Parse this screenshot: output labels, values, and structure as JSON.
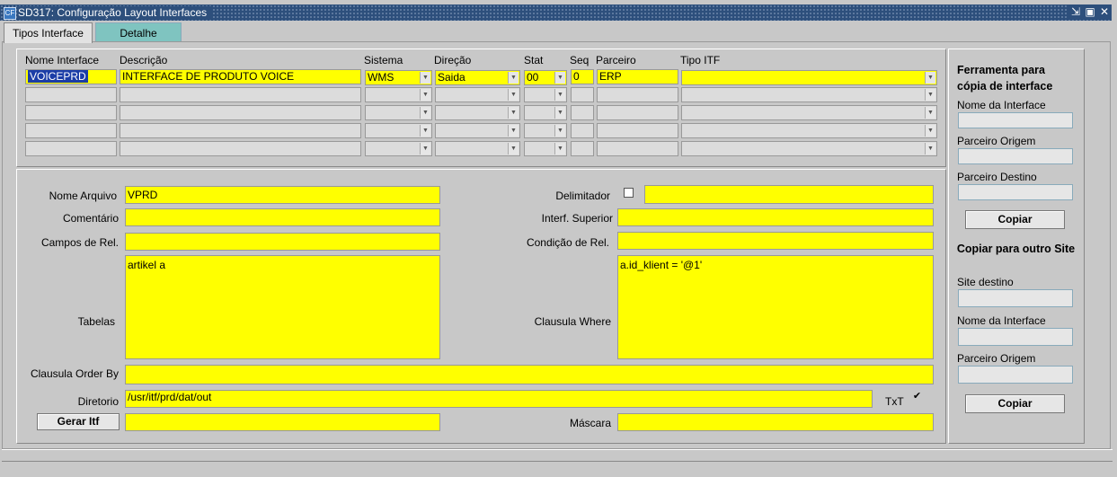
{
  "window": {
    "title": "SD317: Configuração Layout Interfaces",
    "buttons": [
      "⇲",
      "▣",
      "✕"
    ]
  },
  "tabs": [
    {
      "label": "Tipos Interface"
    },
    {
      "label": "Detalhe"
    }
  ],
  "grid": {
    "headers": [
      "Nome Interface",
      "Descrição",
      "Sistema",
      "Direção",
      "Stat",
      "Seq",
      "Parceiro",
      "Tipo ITF"
    ],
    "row1": {
      "nome": "VOICEPRD",
      "descricao": "INTERFACE DE PRODUTO VOICE",
      "sistema": "WMS",
      "direcao": "Saida",
      "stat": "00",
      "seq": "0",
      "parceiro": "ERP",
      "tipo": ""
    }
  },
  "form": {
    "nome_arquivo_label": "Nome Arquivo",
    "nome_arquivo": "VPRD",
    "comentario_label": "Comentário",
    "comentario": "",
    "campos_rel_label": "Campos de Rel.",
    "campos_rel": "",
    "tabelas_label": "Tabelas",
    "tabelas": "artikel a",
    "order_by_label": "Clausula Order By",
    "order_by": "",
    "diretorio_label": "Diretorio",
    "diretorio": "/usr/itf/prd/dat/out",
    "gerar_label": "Gerar Itf",
    "gerar_value": "",
    "delimitador_label": "Delimitador",
    "delimitador": "",
    "interf_sup_label": "Interf. Superior",
    "interf_sup": "",
    "condicao_label": "Condição de Rel.",
    "condicao": "",
    "where_label": "Clausula Where",
    "where": "a.id_klient = '@1'",
    "txt_label": "TxT",
    "txt_checked": "✔",
    "mascara_label": "Máscara",
    "mascara": ""
  },
  "side": {
    "tool_title": "Ferramenta para cópia de interface",
    "nome_label": "Nome da Interface",
    "nome": "",
    "origem_label": "Parceiro Origem",
    "origem": "",
    "destino_label": "Parceiro Destino",
    "destino": "",
    "copiar_label": "Copiar",
    "site_title": "Copiar para outro Site",
    "site_dest_label": "Site destino",
    "site_dest": "",
    "nome2_label": "Nome da Interface",
    "nome2": "",
    "origem2_label": "Parceiro Origem",
    "origem2": "",
    "copiar2_label": "Copiar"
  },
  "colors": {
    "field": "#ffff00",
    "titlebar": "#2d4f7c",
    "tab_inactive": "#7fc4c0",
    "selection": "#1b3da7"
  }
}
